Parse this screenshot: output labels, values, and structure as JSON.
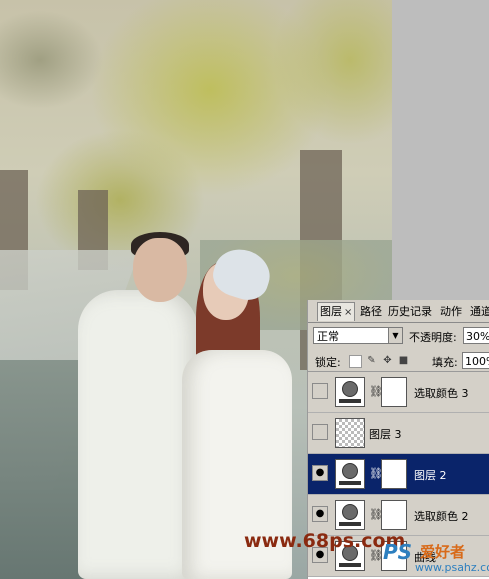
{
  "tabs": [
    {
      "label": "图层",
      "active": true,
      "close": "×"
    },
    {
      "label": "路径",
      "active": false
    },
    {
      "label": "历史记录",
      "active": false
    },
    {
      "label": "动作",
      "active": false
    },
    {
      "label": "通道",
      "active": false
    }
  ],
  "blend_mode": "正常",
  "opacity_label": "不透明度:",
  "opacity_value": "30%",
  "lock_label": "锁定:",
  "fill_label": "填充:",
  "fill_value": "100%",
  "layers": [
    {
      "name": "选取颜色 3",
      "type": "adjustment",
      "visible": false,
      "selected": false
    },
    {
      "name": "图层 3",
      "type": "pixel",
      "visible": false,
      "selected": false
    },
    {
      "name": "图层 2",
      "type": "adjustment",
      "visible": true,
      "selected": true
    },
    {
      "name": "选取颜色 2",
      "type": "adjustment",
      "visible": true,
      "selected": false
    },
    {
      "name": "曲线",
      "type": "adjustment",
      "visible": true,
      "selected": false
    }
  ],
  "watermark": {
    "site": "www.68ps.com",
    "logo": "PS",
    "logo_cn": "爱好者",
    "url": "www.psahz.com"
  },
  "colors": {
    "panel_bg": "#d4d0c8",
    "selected_row": "#0a246a",
    "watermark_site": "#8a2a10",
    "logo_blue": "#2d7fbf",
    "logo_orange": "#d86a19"
  }
}
